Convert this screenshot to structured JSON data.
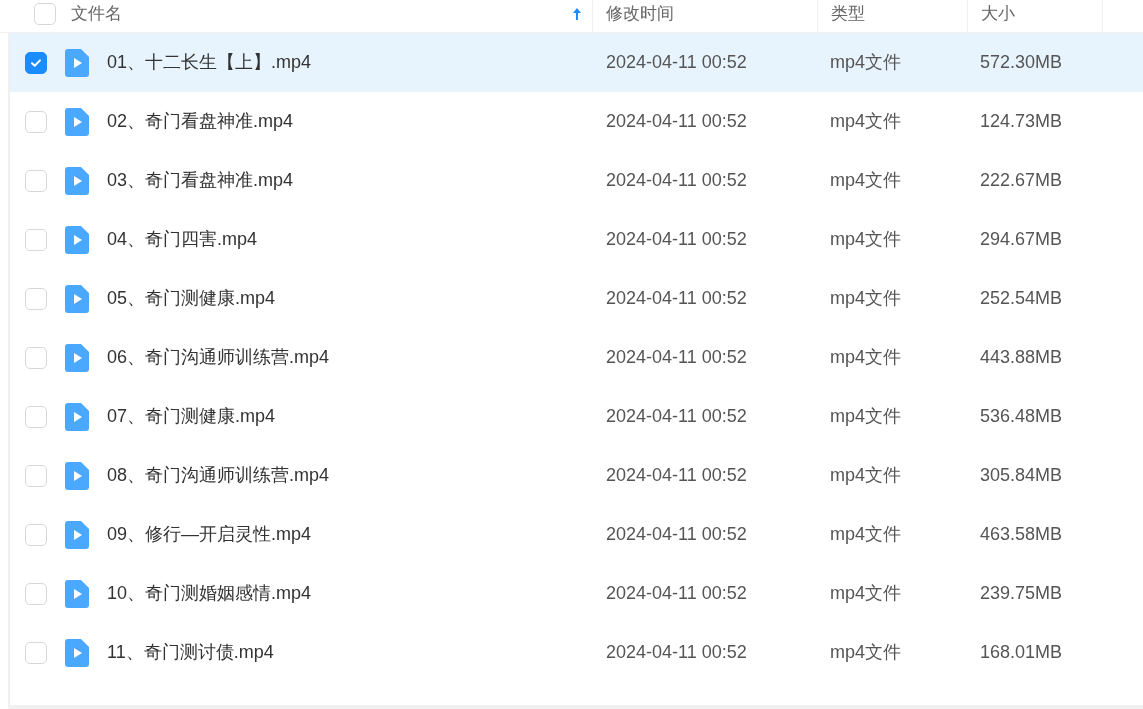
{
  "columns": [
    {
      "label": "文件名",
      "sorted": true
    },
    {
      "label": "修改时间",
      "sorted": false
    },
    {
      "label": "类型",
      "sorted": false
    },
    {
      "label": "大小",
      "sorted": false
    }
  ],
  "header_checkbox": {
    "checked": false
  },
  "rows": [
    {
      "name": "01、十二长生【上】.mp4",
      "modified": "2024-04-11 00:52",
      "type": "mp4文件",
      "size": "572.30MB",
      "selected": true
    },
    {
      "name": "02、奇门看盘神准.mp4",
      "modified": "2024-04-11 00:52",
      "type": "mp4文件",
      "size": "124.73MB",
      "selected": false
    },
    {
      "name": "03、奇门看盘神准.mp4",
      "modified": "2024-04-11 00:52",
      "type": "mp4文件",
      "size": "222.67MB",
      "selected": false
    },
    {
      "name": "04、奇门四害.mp4",
      "modified": "2024-04-11 00:52",
      "type": "mp4文件",
      "size": "294.67MB",
      "selected": false
    },
    {
      "name": "05、奇门测健康.mp4",
      "modified": "2024-04-11 00:52",
      "type": "mp4文件",
      "size": "252.54MB",
      "selected": false
    },
    {
      "name": "06、奇门沟通师训练营.mp4",
      "modified": "2024-04-11 00:52",
      "type": "mp4文件",
      "size": "443.88MB",
      "selected": false
    },
    {
      "name": "07、奇门测健康.mp4",
      "modified": "2024-04-11 00:52",
      "type": "mp4文件",
      "size": "536.48MB",
      "selected": false
    },
    {
      "name": "08、奇门沟通师训练营.mp4",
      "modified": "2024-04-11 00:52",
      "type": "mp4文件",
      "size": "305.84MB",
      "selected": false
    },
    {
      "name": "09、修行—开启灵性.mp4",
      "modified": "2024-04-11 00:52",
      "type": "mp4文件",
      "size": "463.58MB",
      "selected": false
    },
    {
      "name": "10、奇门测婚姻感情.mp4",
      "modified": "2024-04-11 00:52",
      "type": "mp4文件",
      "size": "239.75MB",
      "selected": false
    },
    {
      "name": "11、奇门测讨债.mp4",
      "modified": "2024-04-11 00:52",
      "type": "mp4文件",
      "size": "168.01MB",
      "selected": false
    }
  ]
}
